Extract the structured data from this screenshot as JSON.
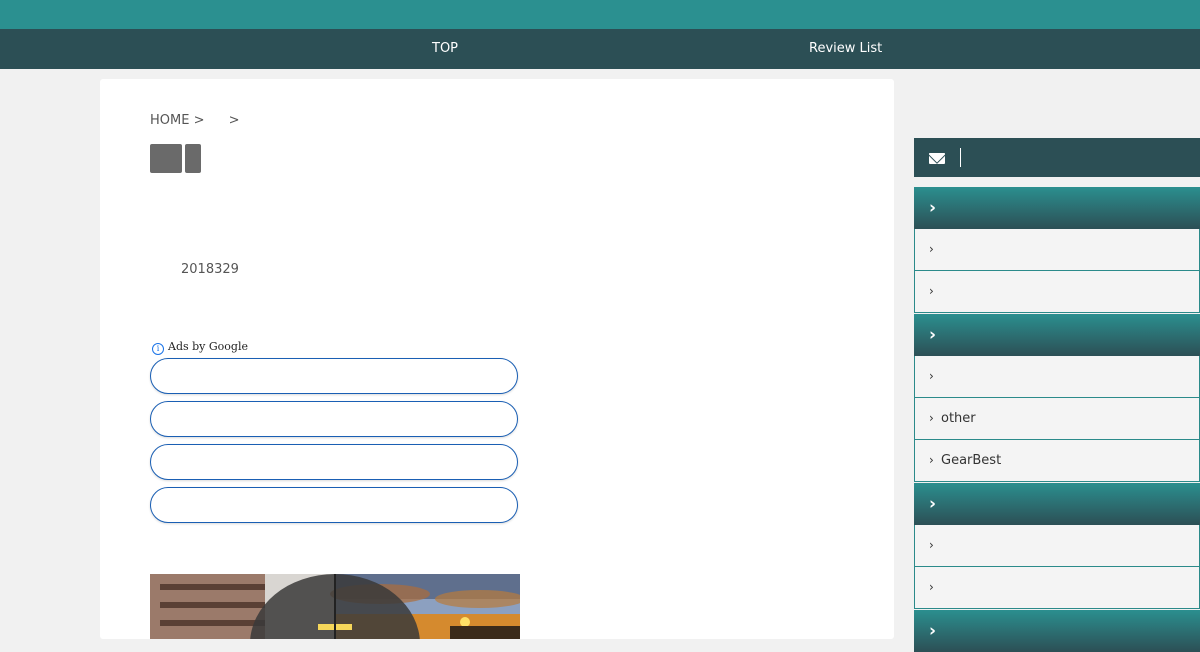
{
  "nav": {
    "top": "TOP",
    "review_list": "Review List"
  },
  "breadcrumb": {
    "home": "HOME >",
    "sep": ">"
  },
  "post": {
    "date": "2018329"
  },
  "ads": {
    "info_glyph": "i",
    "label": "Ads by Google"
  },
  "sidebar": {
    "sections": [
      {
        "items": [
          "",
          ""
        ]
      },
      {
        "items": [
          "",
          "other",
          "GearBest"
        ]
      },
      {
        "items": [
          "",
          ""
        ]
      },
      {
        "items": []
      }
    ]
  },
  "colors": {
    "topbar": "#2b9090",
    "navbar": "#2c4f55",
    "accent": "#2b8f8f",
    "ad_border": "#1a5fb4"
  },
  "icons": {
    "mail": "mail-icon",
    "chevron": "chevron-right-icon"
  }
}
